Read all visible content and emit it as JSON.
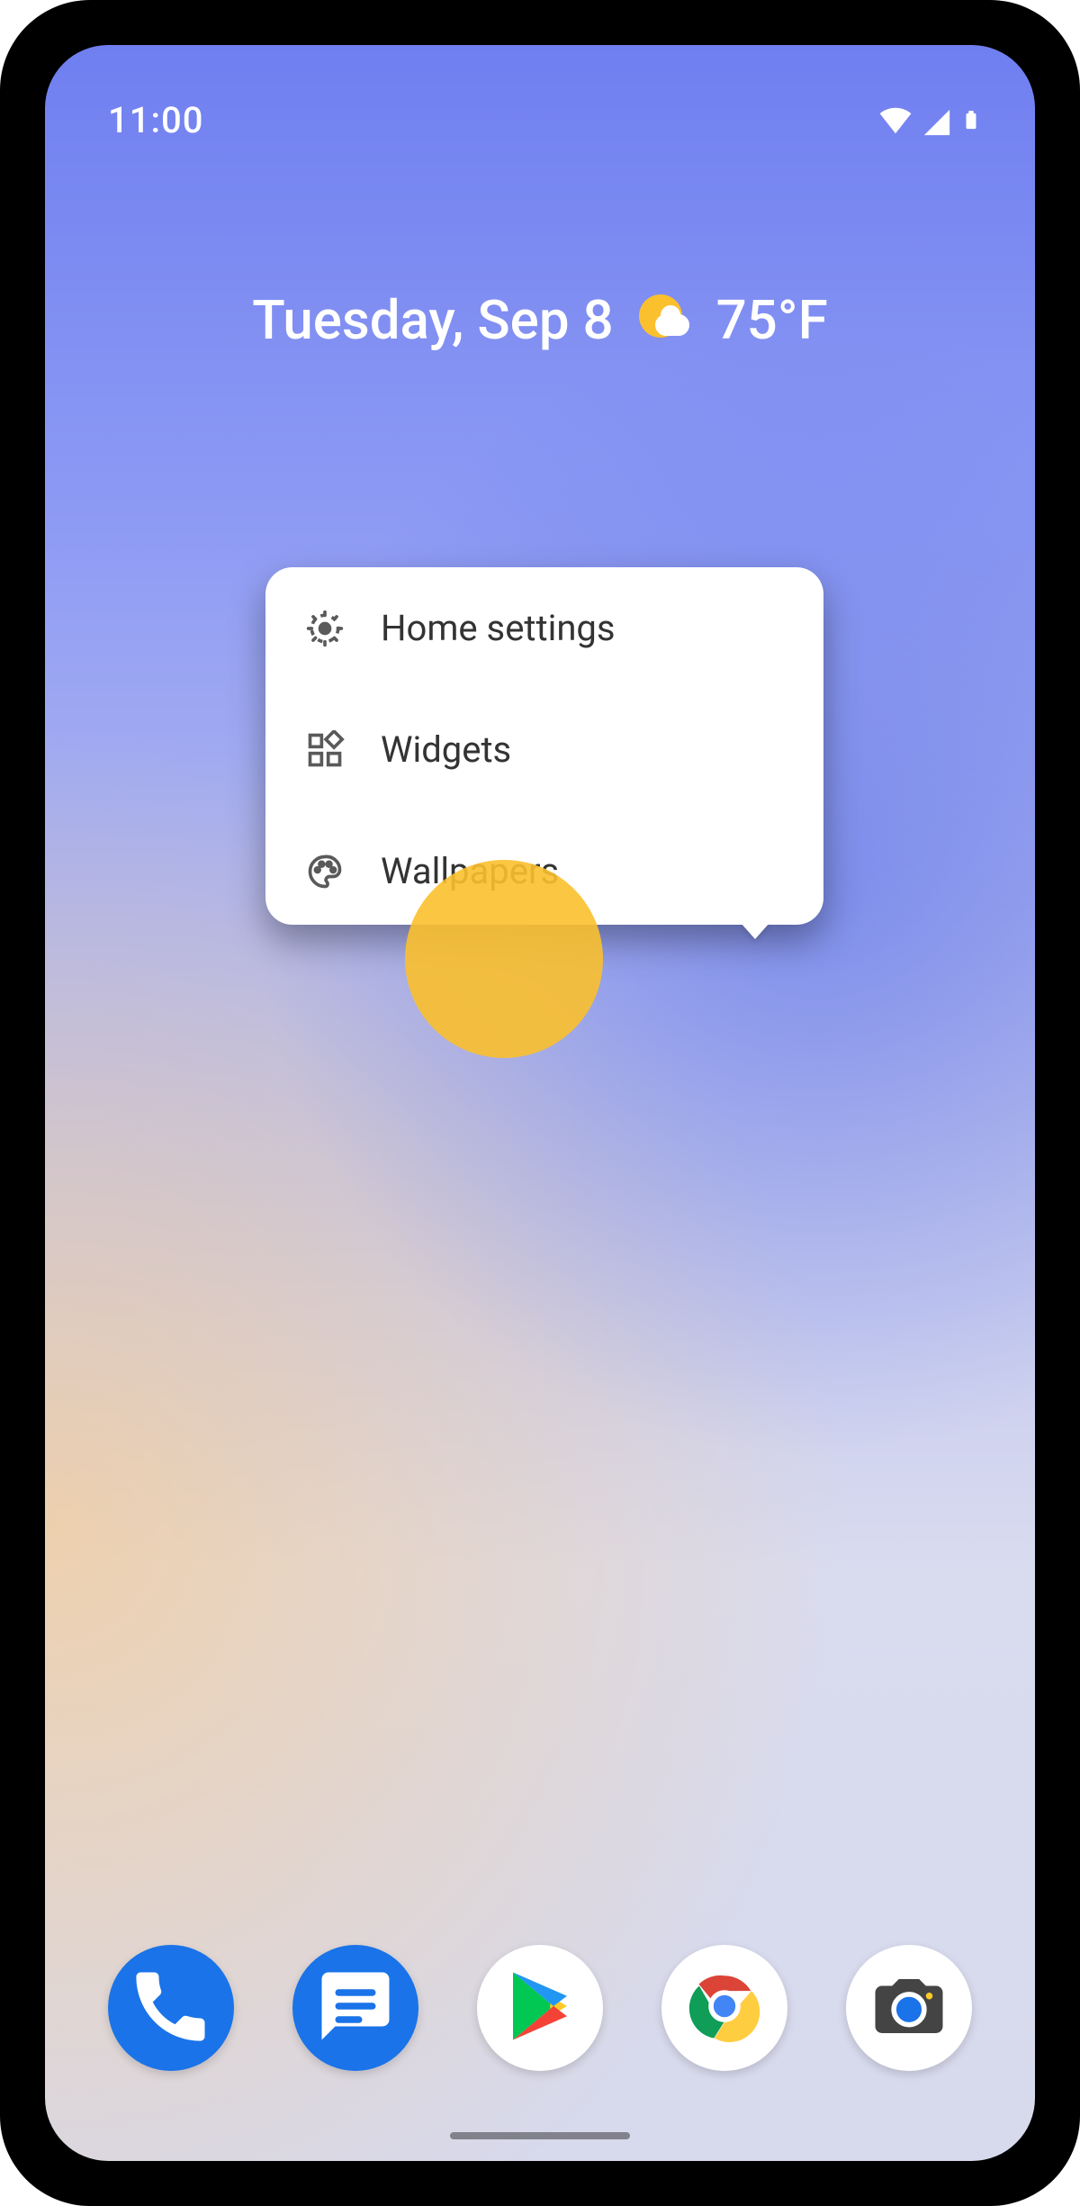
{
  "status": {
    "time": "11:00"
  },
  "homescreen": {
    "date": "Tuesday, Sep 8",
    "weather_icon": "partly-cloudy",
    "temperature": "75°F"
  },
  "context_menu": {
    "items": [
      {
        "icon": "gear-icon",
        "label": "Home settings"
      },
      {
        "icon": "widgets-icon",
        "label": "Widgets"
      },
      {
        "icon": "palette-icon",
        "label": "Wallpapers"
      }
    ],
    "highlighted_index": 2
  },
  "dock": {
    "apps": [
      {
        "name": "Phone",
        "icon": "phone-icon"
      },
      {
        "name": "Messages",
        "icon": "messages-icon"
      },
      {
        "name": "Play Store",
        "icon": "playstore-icon"
      },
      {
        "name": "Chrome",
        "icon": "chrome-icon"
      },
      {
        "name": "Camera",
        "icon": "camera-icon"
      }
    ]
  }
}
